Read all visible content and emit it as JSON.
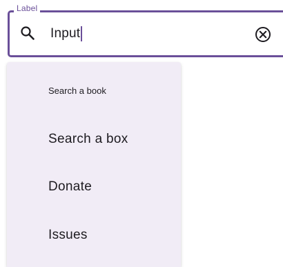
{
  "search_field": {
    "label": "Label",
    "value": "Input",
    "leading_icon": "search-icon",
    "trailing_icon": "clear-circle-icon",
    "accent_color": "#6a4f99"
  },
  "menu": {
    "background_color": "#f1ecf6",
    "items": [
      {
        "label": "Search a book"
      },
      {
        "label": "Search a box"
      },
      {
        "label": "Donate"
      },
      {
        "label": "Issues"
      }
    ]
  }
}
